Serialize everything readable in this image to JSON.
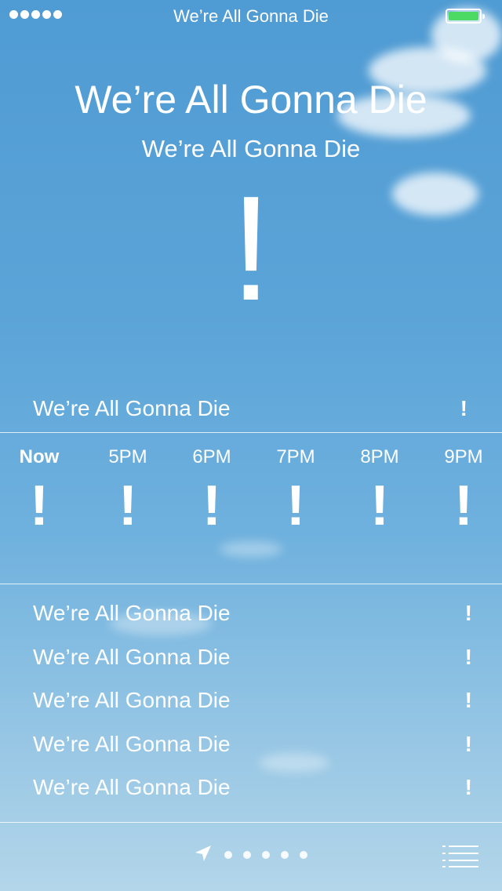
{
  "status_bar": {
    "signal_dots": 5,
    "title": "We’re All Gonna Die",
    "battery_color": "#4cd964"
  },
  "header": {
    "location": "We’re All Gonna Die",
    "condition": "We’re All Gonna Die",
    "temperature": "!"
  },
  "today": {
    "label": "We’re All Gonna Die",
    "value": "!"
  },
  "hourly": [
    {
      "time": "Now",
      "value": "!"
    },
    {
      "time": "5PM",
      "value": "!"
    },
    {
      "time": "6PM",
      "value": "!"
    },
    {
      "time": "7PM",
      "value": "!"
    },
    {
      "time": "8PM",
      "value": "!"
    },
    {
      "time": "9PM",
      "value": "!"
    }
  ],
  "daily": [
    {
      "label": "We’re All Gonna Die",
      "value": "!"
    },
    {
      "label": "We’re All Gonna Die",
      "value": "!"
    },
    {
      "label": "We’re All Gonna Die",
      "value": "!"
    },
    {
      "label": "We’re All Gonna Die",
      "value": "!"
    },
    {
      "label": "We’re All Gonna Die",
      "value": "!"
    }
  ],
  "bottom_bar": {
    "location_icon": "location-arrow-icon",
    "page_count": 5,
    "list_icon": "list-icon"
  }
}
